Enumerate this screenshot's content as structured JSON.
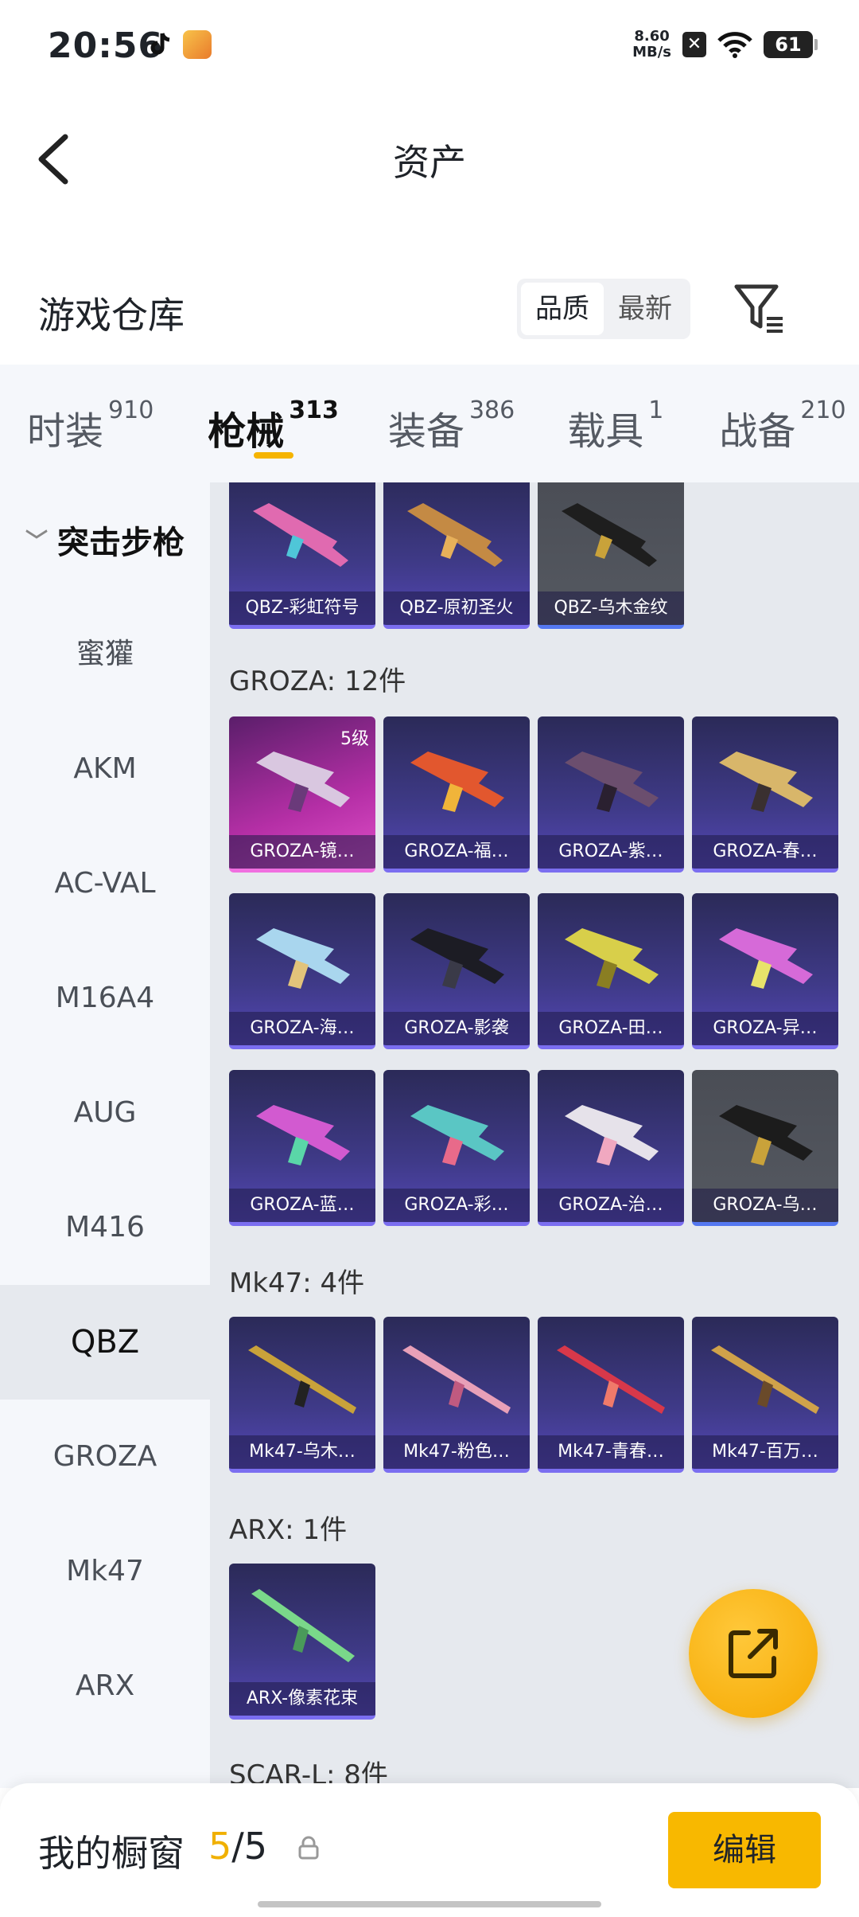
{
  "status_bar": {
    "time": "20:56",
    "net_speed_value": "8.60",
    "net_speed_unit": "MB/s",
    "battery": "61",
    "icons": [
      "tiktok-icon",
      "app-icon",
      "x-icon",
      "wifi-icon",
      "battery-icon"
    ]
  },
  "header": {
    "title": "资产"
  },
  "warehouse": {
    "title": "游戏仓库",
    "sort_options": [
      "品质",
      "最新"
    ],
    "active_sort": "品质"
  },
  "category_tabs": [
    {
      "name": "时装",
      "count": "910"
    },
    {
      "name": "枪械",
      "count": "313",
      "active": true
    },
    {
      "name": "装备",
      "count": "386"
    },
    {
      "name": "载具",
      "count": "1"
    },
    {
      "name": "战备",
      "count": "210"
    }
  ],
  "sidebar": {
    "group": "突击步枪",
    "items": [
      "蜜獾",
      "AKM",
      "AC-VAL",
      "M16A4",
      "AUG",
      "M416",
      "QBZ",
      "GROZA",
      "Mk47",
      "ARX"
    ],
    "active": "QBZ"
  },
  "sections": {
    "qbz": {
      "items": [
        "QBZ-彩虹符号",
        "QBZ-原初圣火",
        "QBZ-乌木金纹"
      ]
    },
    "groza": {
      "title": "GROZA: 12件",
      "items": [
        "GROZA-镜…",
        "GROZA-福…",
        "GROZA-紫…",
        "GROZA-春…",
        "GROZA-海…",
        "GROZA-影袭",
        "GROZA-田…",
        "GROZA-异…",
        "GROZA-蓝…",
        "GROZA-彩…",
        "GROZA-治…",
        "GROZA-乌…"
      ],
      "first_level": "5级"
    },
    "mk47": {
      "title": "Mk47: 4件",
      "items": [
        "Mk47-乌木…",
        "Mk47-粉色…",
        "Mk47-青春…",
        "Mk47-百万…"
      ]
    },
    "arx": {
      "title": "ARX: 1件",
      "items": [
        "ARX-像素花束"
      ]
    },
    "scar": {
      "title": "SCAR-L: 8件"
    }
  },
  "bottom_bar": {
    "title": "我的橱窗",
    "count_current": "5",
    "count_sep_total": "/5",
    "edit_label": "编辑"
  },
  "colors": {
    "accent": "#f5b400",
    "card_purple": "#3f3a88",
    "card_pink": "#b52fa6",
    "card_gray": "#555961"
  }
}
